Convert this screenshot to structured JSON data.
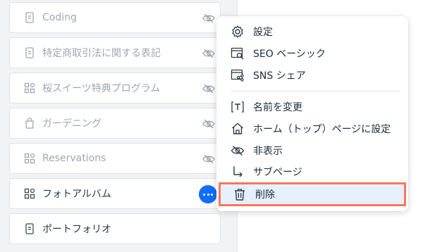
{
  "pages": [
    {
      "label": "Coding",
      "icon": "page-icon",
      "hidden": true
    },
    {
      "label": "特定商取引法に関する表記",
      "icon": "page-icon",
      "hidden": true
    },
    {
      "label": "桜スイーツ特典プログラム",
      "icon": "app-icon",
      "hidden": true
    },
    {
      "label": "ガーデニング",
      "icon": "shopping-bag-icon",
      "hidden": true
    },
    {
      "label": "Reservations",
      "icon": "app-icon",
      "hidden": true
    },
    {
      "label": "フォトアルバム",
      "icon": "app-icon",
      "hidden": false,
      "selected": true
    },
    {
      "label": "ポートフォリオ",
      "icon": "page-icon",
      "hidden": false
    }
  ],
  "menu": {
    "items": [
      {
        "label": "設定",
        "icon": "gear-icon"
      },
      {
        "label": "SEO ベーシック",
        "icon": "seo-search-icon"
      },
      {
        "label": "SNS シェア",
        "icon": "share-icon"
      },
      {
        "label": "名前を変更",
        "icon": "rename-icon"
      },
      {
        "label": "ホーム（トップ）ページに設定",
        "icon": "home-icon"
      },
      {
        "label": "非表示",
        "icon": "eye-hidden-icon"
      },
      {
        "label": "サブページ",
        "icon": "subpage-arrow-icon"
      },
      {
        "label": "削除",
        "icon": "trash-icon",
        "highlighted": true
      }
    ]
  },
  "colors": {
    "accent": "#116dff",
    "highlight_border": "#f4795b",
    "highlight_bg": "#e7f0ff"
  }
}
